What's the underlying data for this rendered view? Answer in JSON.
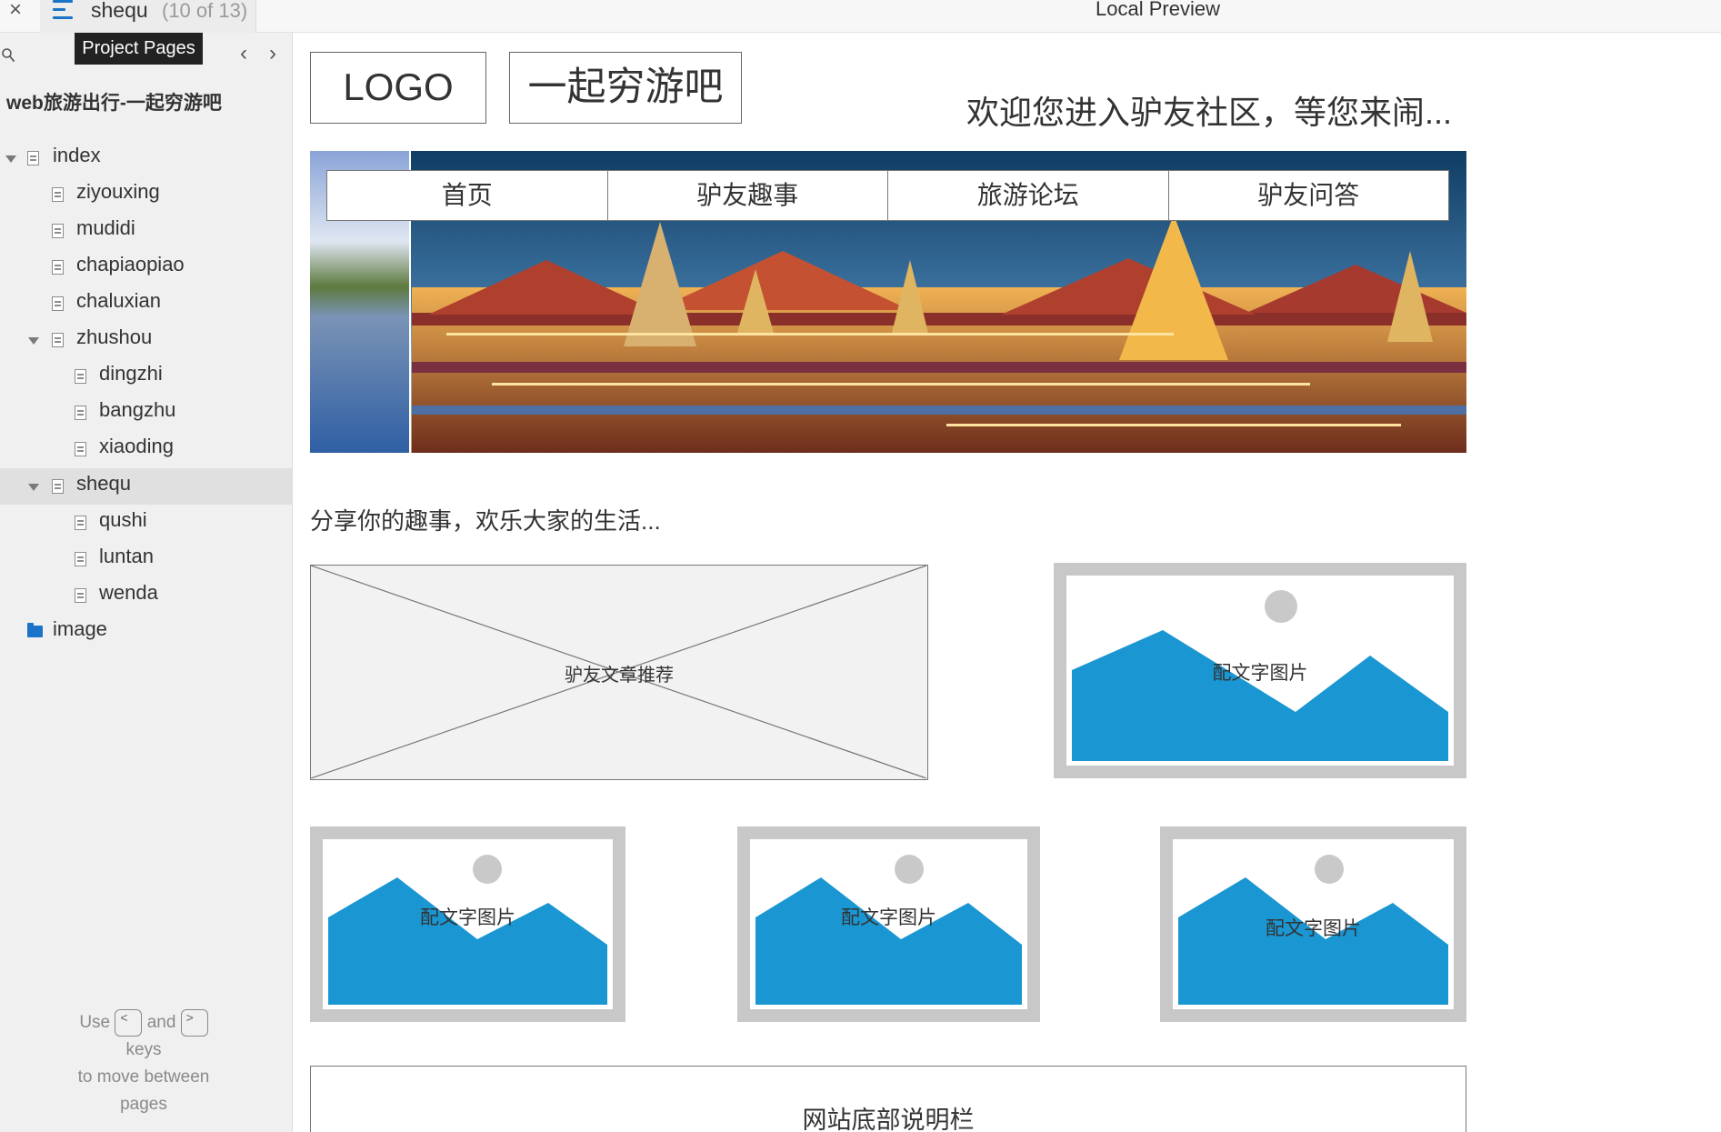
{
  "topbar": {
    "close_glyph": "×",
    "current_page": "shequ",
    "page_count": "(10 of 13)",
    "preview_title": "Local Preview",
    "menu_icon": "hamburger-menu-icon",
    "accent": "#1a73c8"
  },
  "sidebar": {
    "tooltip": "Project Pages",
    "prev_glyph": "‹",
    "next_glyph": "›",
    "project_title": "web旅游出行-一起穷游吧",
    "tree": [
      {
        "label": "index",
        "level": 0,
        "expanded": true,
        "type": "page"
      },
      {
        "label": "ziyouxing",
        "level": 1,
        "type": "page"
      },
      {
        "label": "mudidi",
        "level": 1,
        "type": "page"
      },
      {
        "label": "chapiaopiao",
        "level": 1,
        "type": "page"
      },
      {
        "label": "chaluxian",
        "level": 1,
        "type": "page"
      },
      {
        "label": "zhushou",
        "level": 1,
        "expanded": true,
        "type": "page"
      },
      {
        "label": "dingzhi",
        "level": 2,
        "type": "page"
      },
      {
        "label": "bangzhu",
        "level": 2,
        "type": "page"
      },
      {
        "label": "xiaoding",
        "level": 2,
        "type": "page"
      },
      {
        "label": "shequ",
        "level": 1,
        "expanded": true,
        "type": "page",
        "selected": true
      },
      {
        "label": "qushi",
        "level": 2,
        "type": "page"
      },
      {
        "label": "luntan",
        "level": 2,
        "type": "page"
      },
      {
        "label": "wenda",
        "level": 2,
        "type": "page"
      },
      {
        "label": "image",
        "level": 0,
        "type": "folder"
      }
    ],
    "hint": {
      "use": "Use",
      "key_prev": "<",
      "and": "and",
      "key_next": ">",
      "keys": "keys",
      "line3": "to move between",
      "line4": "pages"
    }
  },
  "preview": {
    "logo": "LOGO",
    "brand": "一起穷游吧",
    "welcome": "欢迎您进入驴友社区，等您来闹...",
    "nav": [
      "首页",
      "驴友趣事",
      "旅游论坛",
      "驴友问答"
    ],
    "share_text": "分享你的趣事，欢乐大家的生活...",
    "article_placeholder": "驴友文章推荐",
    "image_caption": "配文字图片",
    "image_captions": [
      "配文字图片",
      "配文字图片",
      "配文字图片",
      "配文字图片"
    ],
    "footer": "网站底部说明栏",
    "image_placeholder_color": "#1a96d2"
  }
}
